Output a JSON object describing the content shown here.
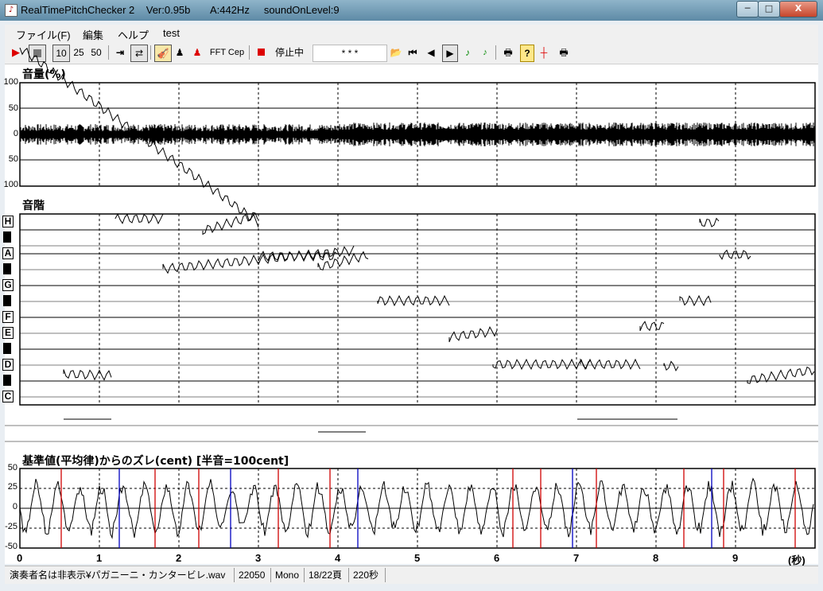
{
  "window": {
    "title": "RealTimePitchChecker 2    Ver:0.95b       A:442Hz     soundOnLevel:9",
    "app_icon": "music-note-icon",
    "controls": {
      "minimize": "─",
      "maximize": "□",
      "close": "X"
    }
  },
  "menu": [
    {
      "label": "ファイル(F)"
    },
    {
      "label": "編集"
    },
    {
      "label": "ヘルプ"
    },
    {
      "label": "test"
    }
  ],
  "toolbar": {
    "speed_10": "10",
    "speed_25": "25",
    "speed_50": "50",
    "fft": "FFT",
    "cep": "Cep",
    "status": "停止中",
    "stars": "* * *",
    "icons": [
      "play-icon",
      "stop-icon",
      "jump-end-icon",
      "repeat-icon",
      "violin-icon",
      "person-icon",
      "person-red-icon",
      "record-icon",
      "open-folder-icon",
      "first-icon",
      "prev-icon",
      "next-icon",
      "note-green-icon",
      "note-green-small-icon",
      "printer-icon",
      "help-icon",
      "marker-icon",
      "print-preview-icon"
    ]
  },
  "volume_panel": {
    "title": "音量(%)",
    "yticks": [
      "100",
      "50",
      "0",
      "50",
      "100"
    ]
  },
  "scale_panel": {
    "title": "音階",
    "notes": [
      "H",
      "A",
      "G",
      "F",
      "E",
      "D",
      "C"
    ]
  },
  "deviation_panel": {
    "title": "基準値(平均律)からのズレ(cent) [半音=100cent]",
    "yticks": [
      "50",
      "25",
      "0",
      "-25",
      "-50"
    ]
  },
  "xaxis": {
    "ticks": [
      "0",
      "1",
      "2",
      "3",
      "4",
      "5",
      "6",
      "7",
      "8",
      "9"
    ],
    "unit": "(秒)"
  },
  "statusbar": {
    "file": "演奏者名は非表示¥パガニーニ・カンタービレ.wav",
    "rate": "22050",
    "channels": "Mono",
    "page": "18/22頁",
    "duration": "220秒"
  },
  "colors": {
    "deviation_positive": "#d00000",
    "deviation_negative": "#0000c0",
    "trace": "#000000"
  }
}
